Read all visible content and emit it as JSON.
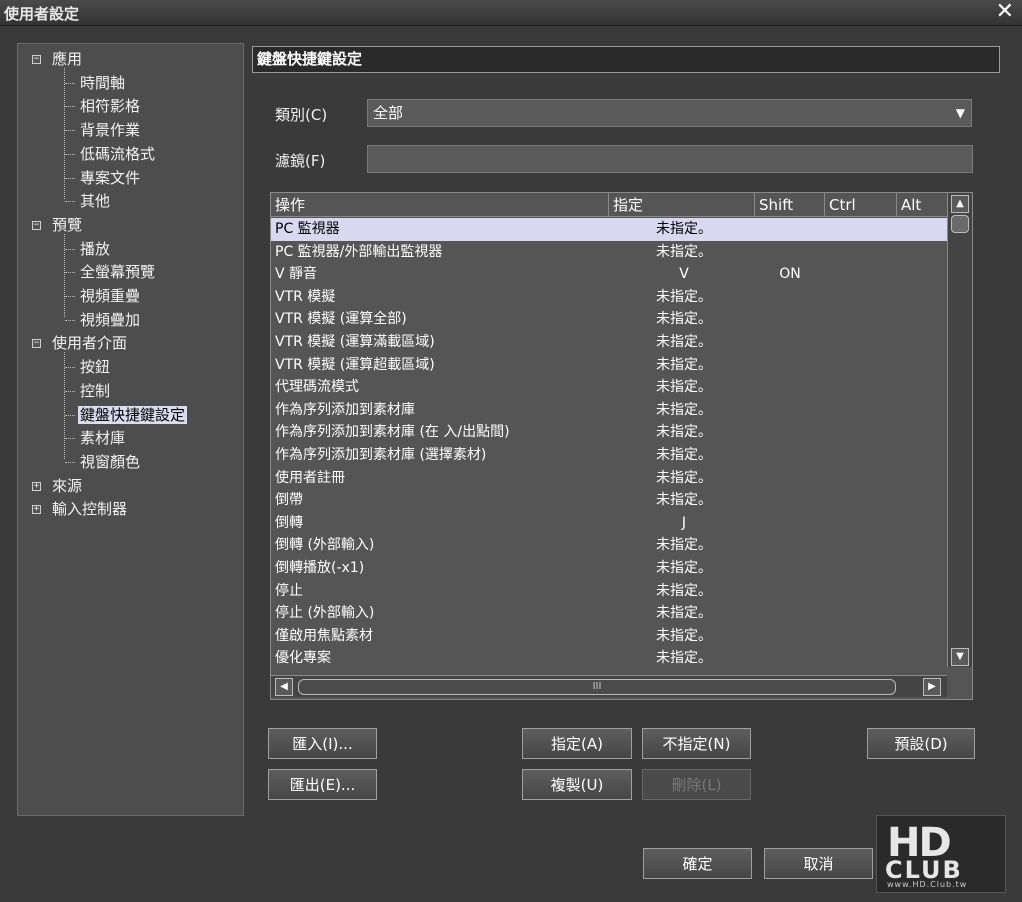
{
  "window": {
    "title": "使用者設定",
    "close": "✕"
  },
  "tree": {
    "groups": [
      {
        "label": "應用",
        "toggle": "−",
        "children": [
          "時間軸",
          "相符影格",
          "背景作業",
          "低碼流格式",
          "專案文件",
          "其他"
        ]
      },
      {
        "label": "預覽",
        "toggle": "−",
        "children": [
          "播放",
          "全螢幕預覽",
          "視頻重疊",
          "視頻疊加"
        ]
      },
      {
        "label": "使用者介面",
        "toggle": "−",
        "children": [
          "按鈕",
          "控制",
          "鍵盤快捷鍵設定",
          "素材庫",
          "視窗顏色"
        ]
      },
      {
        "label": "來源",
        "toggle": "+",
        "children": []
      },
      {
        "label": "輸入控制器",
        "toggle": "+",
        "children": []
      }
    ],
    "selected": "鍵盤快捷鍵設定"
  },
  "panel": {
    "title": "鍵盤快捷鍵設定",
    "category_label": "類別(C)",
    "category_value": "全部",
    "filter_label": "濾鏡(F)",
    "filter_value": ""
  },
  "table": {
    "headers": {
      "action": "操作",
      "key": "指定",
      "shift": "Shift",
      "ctrl": "Ctrl",
      "alt": "Alt"
    },
    "rows": [
      {
        "action": "PC 監視器",
        "key": "未指定。",
        "shift": "",
        "selected": true
      },
      {
        "action": "PC 監視器/外部輸出監視器",
        "key": "未指定。",
        "shift": ""
      },
      {
        "action": "V 靜音",
        "key": "V",
        "shift": "ON"
      },
      {
        "action": "VTR 模擬",
        "key": "未指定。",
        "shift": ""
      },
      {
        "action": "VTR 模擬 (運算全部)",
        "key": "未指定。",
        "shift": ""
      },
      {
        "action": "VTR 模擬 (運算滿載區域)",
        "key": "未指定。",
        "shift": ""
      },
      {
        "action": "VTR 模擬 (運算超載區域)",
        "key": "未指定。",
        "shift": ""
      },
      {
        "action": "代理碼流模式",
        "key": "未指定。",
        "shift": ""
      },
      {
        "action": "作為序列添加到素材庫",
        "key": "未指定。",
        "shift": ""
      },
      {
        "action": "作為序列添加到素材庫 (在 入/出點間)",
        "key": "未指定。",
        "shift": ""
      },
      {
        "action": "作為序列添加到素材庫 (選擇素材)",
        "key": "未指定。",
        "shift": ""
      },
      {
        "action": "使用者註冊",
        "key": "未指定。",
        "shift": ""
      },
      {
        "action": "倒帶",
        "key": "未指定。",
        "shift": ""
      },
      {
        "action": "倒轉",
        "key": "J",
        "shift": ""
      },
      {
        "action": "倒轉 (外部輸入)",
        "key": "未指定。",
        "shift": ""
      },
      {
        "action": "倒轉播放(-x1)",
        "key": "未指定。",
        "shift": ""
      },
      {
        "action": "停止",
        "key": "未指定。",
        "shift": ""
      },
      {
        "action": "停止 (外部輸入)",
        "key": "未指定。",
        "shift": ""
      },
      {
        "action": "僅啟用焦點素材",
        "key": "未指定。",
        "shift": ""
      },
      {
        "action": "優化專案",
        "key": "未指定。",
        "shift": ""
      }
    ],
    "hscroll_grip": "III"
  },
  "buttons": {
    "import": "匯入(I)...",
    "export": "匯出(E)...",
    "assign": "指定(A)",
    "unassign": "不指定(N)",
    "copy": "複製(U)",
    "delete": "刪除(L)",
    "default": "預設(D)",
    "ok": "確定",
    "cancel": "取消"
  },
  "watermark": {
    "logo": "HD",
    "club": "CLUB",
    "url": "www.HD.Club.tw"
  }
}
